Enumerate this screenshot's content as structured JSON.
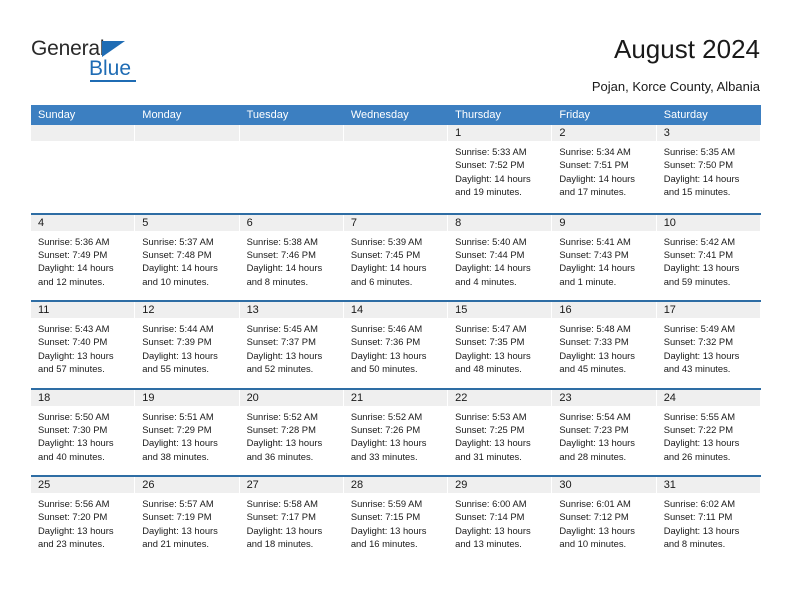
{
  "brand": {
    "name_part1": "General",
    "name_part2": "Blue",
    "accent_color": "#1f6cb4"
  },
  "header": {
    "title": "August 2024",
    "subtitle": "Pojan, Korce County, Albania"
  },
  "calendar": {
    "header_bg": "#3c7fc1",
    "week_rule_color": "#2e6da4",
    "daynum_bg": "#efefef",
    "weekdays": [
      "Sunday",
      "Monday",
      "Tuesday",
      "Wednesday",
      "Thursday",
      "Friday",
      "Saturday"
    ],
    "weeks": [
      [
        {
          "day": "",
          "empty": true,
          "sunrise": "",
          "sunset": "",
          "daylight1": "",
          "daylight2": ""
        },
        {
          "day": "",
          "empty": true,
          "sunrise": "",
          "sunset": "",
          "daylight1": "",
          "daylight2": ""
        },
        {
          "day": "",
          "empty": true,
          "sunrise": "",
          "sunset": "",
          "daylight1": "",
          "daylight2": ""
        },
        {
          "day": "",
          "empty": true,
          "sunrise": "",
          "sunset": "",
          "daylight1": "",
          "daylight2": ""
        },
        {
          "day": "1",
          "empty": false,
          "sunrise": "Sunrise: 5:33 AM",
          "sunset": "Sunset: 7:52 PM",
          "daylight1": "Daylight: 14 hours",
          "daylight2": "and 19 minutes."
        },
        {
          "day": "2",
          "empty": false,
          "sunrise": "Sunrise: 5:34 AM",
          "sunset": "Sunset: 7:51 PM",
          "daylight1": "Daylight: 14 hours",
          "daylight2": "and 17 minutes."
        },
        {
          "day": "3",
          "empty": false,
          "sunrise": "Sunrise: 5:35 AM",
          "sunset": "Sunset: 7:50 PM",
          "daylight1": "Daylight: 14 hours",
          "daylight2": "and 15 minutes."
        }
      ],
      [
        {
          "day": "4",
          "empty": false,
          "sunrise": "Sunrise: 5:36 AM",
          "sunset": "Sunset: 7:49 PM",
          "daylight1": "Daylight: 14 hours",
          "daylight2": "and 12 minutes."
        },
        {
          "day": "5",
          "empty": false,
          "sunrise": "Sunrise: 5:37 AM",
          "sunset": "Sunset: 7:48 PM",
          "daylight1": "Daylight: 14 hours",
          "daylight2": "and 10 minutes."
        },
        {
          "day": "6",
          "empty": false,
          "sunrise": "Sunrise: 5:38 AM",
          "sunset": "Sunset: 7:46 PM",
          "daylight1": "Daylight: 14 hours",
          "daylight2": "and 8 minutes."
        },
        {
          "day": "7",
          "empty": false,
          "sunrise": "Sunrise: 5:39 AM",
          "sunset": "Sunset: 7:45 PM",
          "daylight1": "Daylight: 14 hours",
          "daylight2": "and 6 minutes."
        },
        {
          "day": "8",
          "empty": false,
          "sunrise": "Sunrise: 5:40 AM",
          "sunset": "Sunset: 7:44 PM",
          "daylight1": "Daylight: 14 hours",
          "daylight2": "and 4 minutes."
        },
        {
          "day": "9",
          "empty": false,
          "sunrise": "Sunrise: 5:41 AM",
          "sunset": "Sunset: 7:43 PM",
          "daylight1": "Daylight: 14 hours",
          "daylight2": "and 1 minute."
        },
        {
          "day": "10",
          "empty": false,
          "sunrise": "Sunrise: 5:42 AM",
          "sunset": "Sunset: 7:41 PM",
          "daylight1": "Daylight: 13 hours",
          "daylight2": "and 59 minutes."
        }
      ],
      [
        {
          "day": "11",
          "empty": false,
          "sunrise": "Sunrise: 5:43 AM",
          "sunset": "Sunset: 7:40 PM",
          "daylight1": "Daylight: 13 hours",
          "daylight2": "and 57 minutes."
        },
        {
          "day": "12",
          "empty": false,
          "sunrise": "Sunrise: 5:44 AM",
          "sunset": "Sunset: 7:39 PM",
          "daylight1": "Daylight: 13 hours",
          "daylight2": "and 55 minutes."
        },
        {
          "day": "13",
          "empty": false,
          "sunrise": "Sunrise: 5:45 AM",
          "sunset": "Sunset: 7:37 PM",
          "daylight1": "Daylight: 13 hours",
          "daylight2": "and 52 minutes."
        },
        {
          "day": "14",
          "empty": false,
          "sunrise": "Sunrise: 5:46 AM",
          "sunset": "Sunset: 7:36 PM",
          "daylight1": "Daylight: 13 hours",
          "daylight2": "and 50 minutes."
        },
        {
          "day": "15",
          "empty": false,
          "sunrise": "Sunrise: 5:47 AM",
          "sunset": "Sunset: 7:35 PM",
          "daylight1": "Daylight: 13 hours",
          "daylight2": "and 48 minutes."
        },
        {
          "day": "16",
          "empty": false,
          "sunrise": "Sunrise: 5:48 AM",
          "sunset": "Sunset: 7:33 PM",
          "daylight1": "Daylight: 13 hours",
          "daylight2": "and 45 minutes."
        },
        {
          "day": "17",
          "empty": false,
          "sunrise": "Sunrise: 5:49 AM",
          "sunset": "Sunset: 7:32 PM",
          "daylight1": "Daylight: 13 hours",
          "daylight2": "and 43 minutes."
        }
      ],
      [
        {
          "day": "18",
          "empty": false,
          "sunrise": "Sunrise: 5:50 AM",
          "sunset": "Sunset: 7:30 PM",
          "daylight1": "Daylight: 13 hours",
          "daylight2": "and 40 minutes."
        },
        {
          "day": "19",
          "empty": false,
          "sunrise": "Sunrise: 5:51 AM",
          "sunset": "Sunset: 7:29 PM",
          "daylight1": "Daylight: 13 hours",
          "daylight2": "and 38 minutes."
        },
        {
          "day": "20",
          "empty": false,
          "sunrise": "Sunrise: 5:52 AM",
          "sunset": "Sunset: 7:28 PM",
          "daylight1": "Daylight: 13 hours",
          "daylight2": "and 36 minutes."
        },
        {
          "day": "21",
          "empty": false,
          "sunrise": "Sunrise: 5:52 AM",
          "sunset": "Sunset: 7:26 PM",
          "daylight1": "Daylight: 13 hours",
          "daylight2": "and 33 minutes."
        },
        {
          "day": "22",
          "empty": false,
          "sunrise": "Sunrise: 5:53 AM",
          "sunset": "Sunset: 7:25 PM",
          "daylight1": "Daylight: 13 hours",
          "daylight2": "and 31 minutes."
        },
        {
          "day": "23",
          "empty": false,
          "sunrise": "Sunrise: 5:54 AM",
          "sunset": "Sunset: 7:23 PM",
          "daylight1": "Daylight: 13 hours",
          "daylight2": "and 28 minutes."
        },
        {
          "day": "24",
          "empty": false,
          "sunrise": "Sunrise: 5:55 AM",
          "sunset": "Sunset: 7:22 PM",
          "daylight1": "Daylight: 13 hours",
          "daylight2": "and 26 minutes."
        }
      ],
      [
        {
          "day": "25",
          "empty": false,
          "sunrise": "Sunrise: 5:56 AM",
          "sunset": "Sunset: 7:20 PM",
          "daylight1": "Daylight: 13 hours",
          "daylight2": "and 23 minutes."
        },
        {
          "day": "26",
          "empty": false,
          "sunrise": "Sunrise: 5:57 AM",
          "sunset": "Sunset: 7:19 PM",
          "daylight1": "Daylight: 13 hours",
          "daylight2": "and 21 minutes."
        },
        {
          "day": "27",
          "empty": false,
          "sunrise": "Sunrise: 5:58 AM",
          "sunset": "Sunset: 7:17 PM",
          "daylight1": "Daylight: 13 hours",
          "daylight2": "and 18 minutes."
        },
        {
          "day": "28",
          "empty": false,
          "sunrise": "Sunrise: 5:59 AM",
          "sunset": "Sunset: 7:15 PM",
          "daylight1": "Daylight: 13 hours",
          "daylight2": "and 16 minutes."
        },
        {
          "day": "29",
          "empty": false,
          "sunrise": "Sunrise: 6:00 AM",
          "sunset": "Sunset: 7:14 PM",
          "daylight1": "Daylight: 13 hours",
          "daylight2": "and 13 minutes."
        },
        {
          "day": "30",
          "empty": false,
          "sunrise": "Sunrise: 6:01 AM",
          "sunset": "Sunset: 7:12 PM",
          "daylight1": "Daylight: 13 hours",
          "daylight2": "and 10 minutes."
        },
        {
          "day": "31",
          "empty": false,
          "sunrise": "Sunrise: 6:02 AM",
          "sunset": "Sunset: 7:11 PM",
          "daylight1": "Daylight: 13 hours",
          "daylight2": "and 8 minutes."
        }
      ]
    ]
  }
}
